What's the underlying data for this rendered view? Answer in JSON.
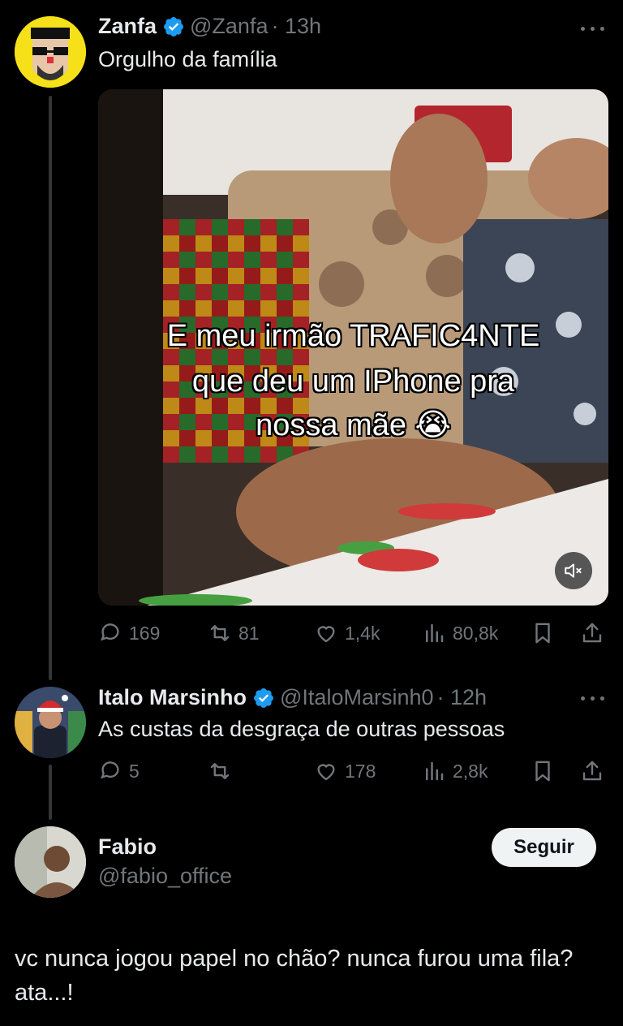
{
  "tweets": [
    {
      "name": "Zanfa",
      "handle": "@Zanfa",
      "time": "· 13h",
      "text": "Orgulho da família",
      "video_caption": [
        "E meu irmão TRAFIC4NTE",
        "que deu um IPhone pra",
        "nossa mãe 😭"
      ],
      "actions": {
        "replies": "169",
        "retweets": "81",
        "likes": "1,4k",
        "views": "80,8k"
      }
    },
    {
      "name": "Italo Marsinho",
      "handle": "@ItaloMarsinh0",
      "time": "· 12h",
      "text": "As custas da desgraça de outras pessoas",
      "actions": {
        "replies": "5",
        "retweets": "",
        "likes": "178",
        "views": "2,8k"
      }
    }
  ],
  "main_post": {
    "name": "Fabio",
    "handle": "@fabio_office",
    "follow_label": "Seguir",
    "text": "vc nunca jogou papel no chão? nunca furou uma fila? ata...!"
  },
  "colors": {
    "verified": "#1d9bf0",
    "muted": "#71767b",
    "text": "#e7e9ea"
  }
}
